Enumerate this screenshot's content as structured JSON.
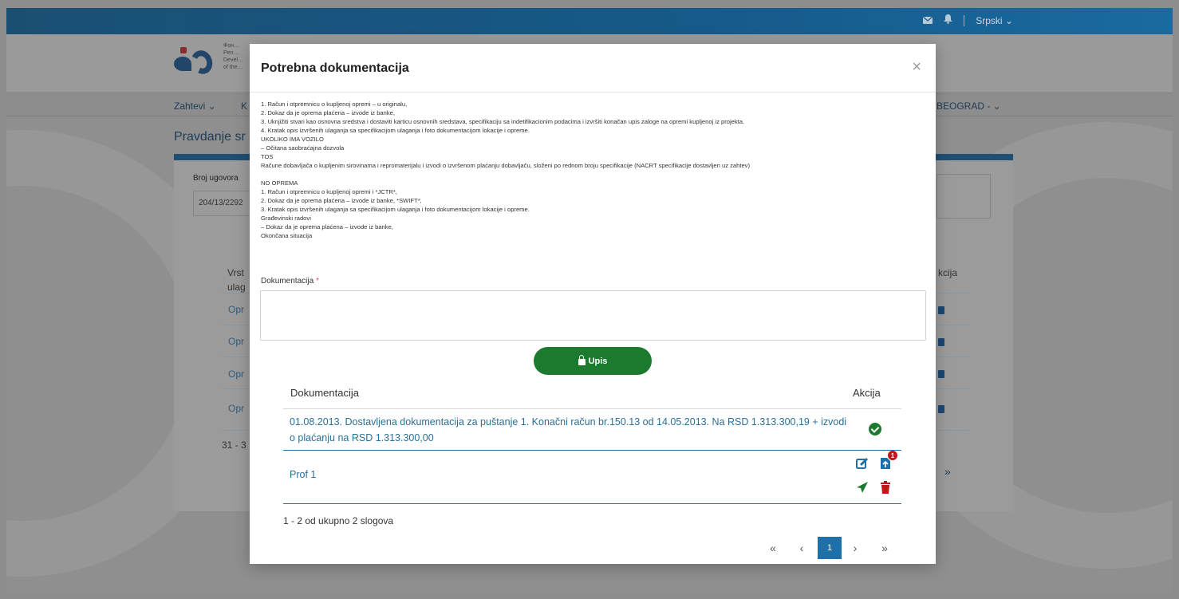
{
  "topbar": {
    "mail_icon": "mail-icon",
    "bell_icon": "bell-icon",
    "language": "Srpski",
    "language_chevron": "⌄"
  },
  "background": {
    "org_text": [
      "Фон…",
      "Pen…",
      "Devel…",
      "of the…"
    ],
    "nav_left": "Zahtevi ⌄",
    "nav_left2": "K",
    "nav_right": "BEOGRAD - ⌄",
    "page_title": "Pravdanje sr",
    "contract_label": "Broj ugovora",
    "contract_value": "204/13/2292",
    "col1": [
      "Vrst",
      "ulag"
    ],
    "col2": "kcija",
    "rows": [
      "Opr",
      "Opr",
      "Opr",
      "Opr"
    ],
    "footer": "31 - 3",
    "last_page": "»"
  },
  "modal": {
    "title": "Potrebna dokumentacija",
    "close": "×",
    "instructions": [
      "1. Račun i otpremnicu o kupljenoj opremi – u originalu,",
      "2. Dokaz da je oprema plaćena – izvode iz banke,",
      "3. Uknjižiti stvari kao osnovna sredstva i dostaviti karticu osnovnih sredstava, specifikaciju sa indetifikacionim podacima i izvršiti konačan upis zaloge na opremi kupljenoj iz projekta.",
      "4. Kratak opis izvršenih ulaganja sa specifikacijom ulaganja i foto dokumentacijom lokacije i opreme.",
      "UKOLIKO IMA VOZILO",
      "– Očitana saobraćajna dozvola",
      "TOS",
      "Račune dobavljača o kupljenim sirovinama i repromaterijalu i izvodi o izvršenom plaćanju dobavljaču, složeni po rednom broju specifikacije (NACRT specifikacije dostavljen uz zahtev)",
      "",
      "NO OPREMA",
      "1. Račun i otpremnicu o kupljenoj opremi i *JCTR*,",
      "2. Dokaz da je oprema plaćena – izvode iz banke, *SWIFT*,",
      "3. Kratak opis izvršenih ulaganja sa specifikacijom ulaganja i foto dokumentacijom lokacije i opreme.",
      "Građevinski radovi",
      "– Dokaz da je oprema plaćena – izvode iz banke,",
      "Okončana situacija"
    ],
    "doc_label": "Dokumentacija",
    "doc_required": "*",
    "doc_value": "",
    "upis_label": "Upis",
    "table": {
      "headers": [
        "Dokumentacija",
        "Akcija"
      ],
      "rows": [
        {
          "text": "01.08.2013. Dostavljena dokumentacija za puštanje 1. Konačni račun br.150.13 od 14.05.2013. Na RSD 1.313.300,19 + izvodi o plaćanju na RSD 1.313.300,00",
          "status_icon": "check-circle-icon"
        },
        {
          "text": "Prof 1",
          "actions": [
            "edit-icon",
            "upload-icon",
            "send-icon",
            "trash-icon"
          ],
          "badge": "1"
        }
      ]
    },
    "pagination": {
      "info": "1 - 2 od ukupno 2 slogova",
      "first": "«",
      "prev": "‹",
      "current": "1",
      "next": "›",
      "last": "»"
    }
  },
  "colors": {
    "primary": "#1f6fa8",
    "success": "#1b7a2e",
    "danger": "#c0171c",
    "link": "#2a6f97"
  }
}
